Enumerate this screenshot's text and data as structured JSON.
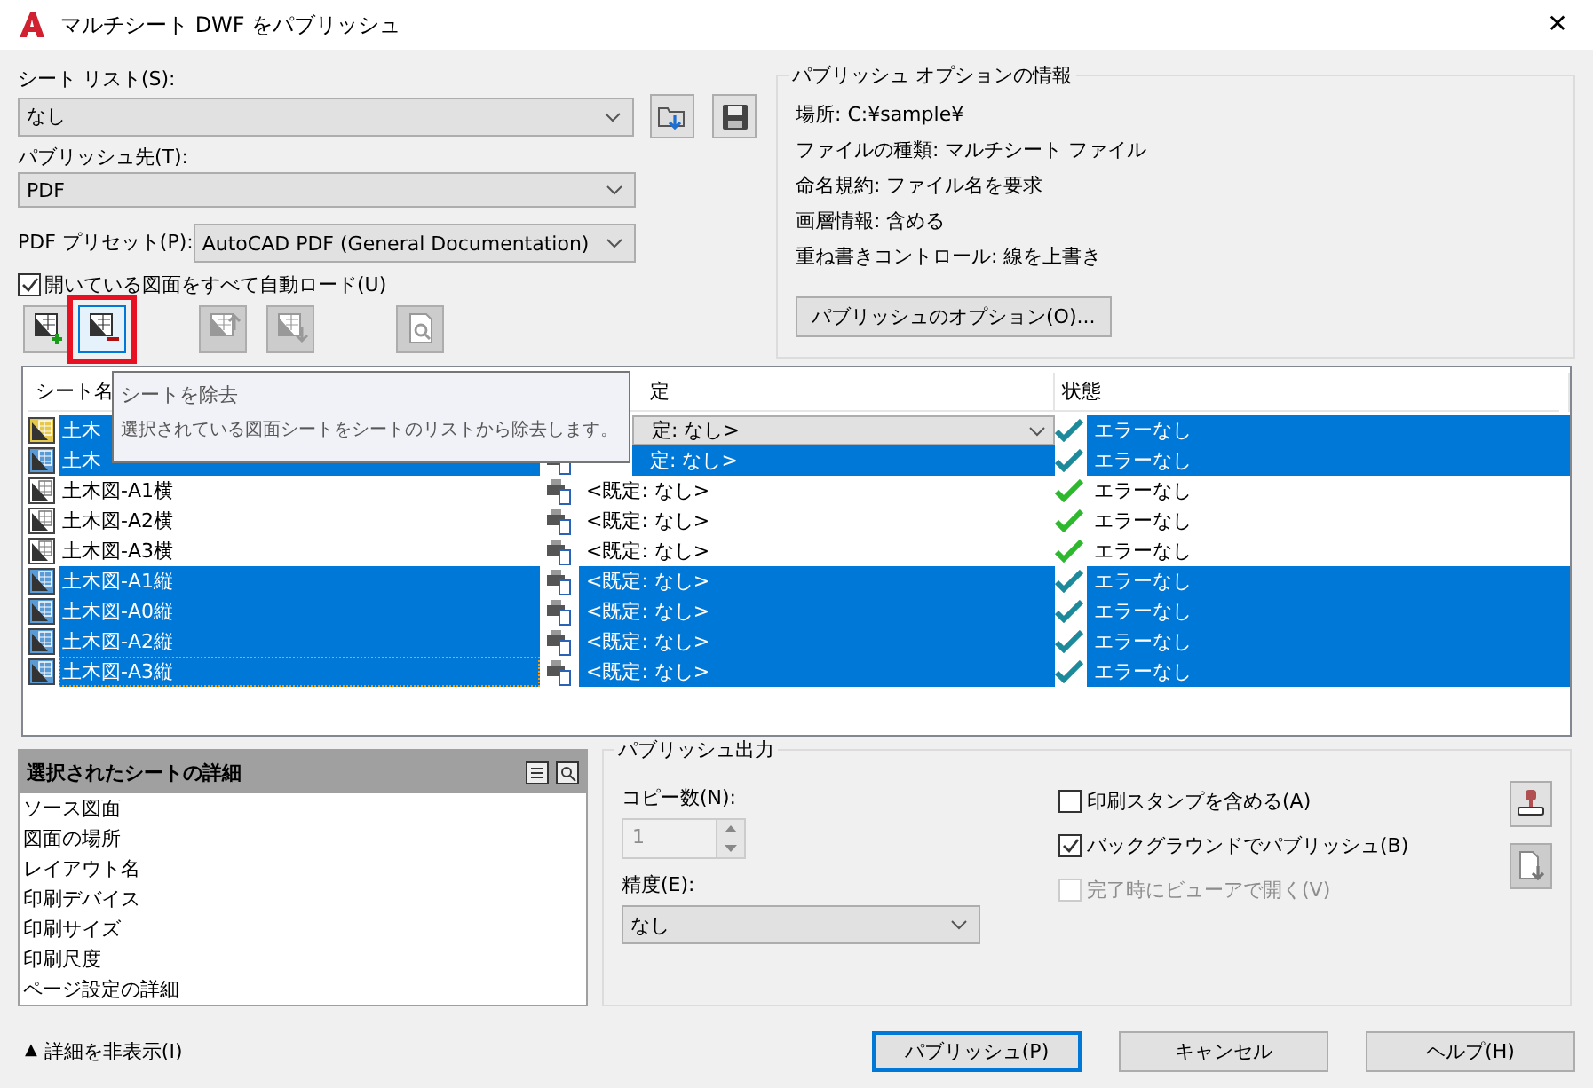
{
  "window": {
    "title": "マルチシート DWF をパブリッシュ",
    "close": "✕"
  },
  "sheet_list": {
    "label": "シート リスト(S):",
    "value": "なし"
  },
  "publish_to": {
    "label": "パブリッシュ先(T):",
    "value": "PDF"
  },
  "pdf_preset": {
    "label": "PDF プリセット(P):",
    "value": "AutoCAD PDF (General Documentation)"
  },
  "auto_load": {
    "label": "開いている図面をすべて自動ロード(U)",
    "checked": true
  },
  "toolbar": [
    {
      "kind": "add",
      "disabled": false,
      "highlighted": false
    },
    {
      "kind": "remove",
      "disabled": false,
      "highlighted": true
    },
    {
      "kind": "up",
      "disabled": true,
      "highlighted": false
    },
    {
      "kind": "down",
      "disabled": true,
      "highlighted": false
    },
    {
      "kind": "preview",
      "disabled": true,
      "highlighted": false
    }
  ],
  "options_info": {
    "title": "パブリッシュ オプションの情報",
    "lines": [
      "場所: C:¥sample¥",
      "ファイルの種類: マルチシート ファイル",
      "命名規約: ファイル名を要求",
      "画層情報: 含める",
      "重ね書きコントロール: 線を上書き"
    ],
    "button": "パブリッシュのオプション(O)..."
  },
  "tooltip": {
    "title": "シートを除去",
    "text": "選択されている図面シートをシートのリストから除去します。"
  },
  "table": {
    "columns": [
      {
        "label": "シート名",
        "clipped": false
      },
      {
        "label": "定",
        "clipped": true
      },
      {
        "label": "状態",
        "clipped": false
      }
    ],
    "rows": [
      {
        "name": "土木",
        "page_setup": "定: なし>",
        "setup_clipped": true,
        "status": "エラーなし",
        "selected": true,
        "current": true,
        "editing": true,
        "focused": false
      },
      {
        "name": "土木",
        "page_setup": "定: なし>",
        "setup_clipped": true,
        "status": "エラーなし",
        "selected": true,
        "current": false,
        "editing": false,
        "focused": false
      },
      {
        "name": "土木図-A1横",
        "page_setup": "<既定: なし>",
        "setup_clipped": false,
        "status": "エラーなし",
        "selected": false,
        "current": false,
        "editing": false,
        "focused": false
      },
      {
        "name": "土木図-A2横",
        "page_setup": "<既定: なし>",
        "setup_clipped": false,
        "status": "エラーなし",
        "selected": false,
        "current": false,
        "editing": false,
        "focused": false
      },
      {
        "name": "土木図-A3横",
        "page_setup": "<既定: なし>",
        "setup_clipped": false,
        "status": "エラーなし",
        "selected": false,
        "current": false,
        "editing": false,
        "focused": false
      },
      {
        "name": "土木図-A1縦",
        "page_setup": "<既定: なし>",
        "setup_clipped": false,
        "status": "エラーなし",
        "selected": true,
        "current": false,
        "editing": false,
        "focused": false
      },
      {
        "name": "土木図-A0縦",
        "page_setup": "<既定: なし>",
        "setup_clipped": false,
        "status": "エラーなし",
        "selected": true,
        "current": false,
        "editing": false,
        "focused": false
      },
      {
        "name": "土木図-A2縦",
        "page_setup": "<既定: なし>",
        "setup_clipped": false,
        "status": "エラーなし",
        "selected": true,
        "current": false,
        "editing": false,
        "focused": false
      },
      {
        "name": "土木図-A3縦",
        "page_setup": "<既定: なし>",
        "setup_clipped": false,
        "status": "エラーなし",
        "selected": true,
        "current": false,
        "editing": false,
        "focused": true
      }
    ]
  },
  "details": {
    "title": "選択されたシートの詳細",
    "items": [
      "ソース図面",
      "図面の場所",
      "レイアウト名",
      "印刷デバイス",
      "印刷サイズ",
      "印刷尺度",
      "ページ設定の詳細"
    ]
  },
  "publish_output": {
    "title": "パブリッシュ出力",
    "copies": {
      "label": "コピー数(N):",
      "value": "1",
      "disabled": true
    },
    "precision": {
      "label": "精度(E):",
      "value": "なし"
    },
    "checkboxes": [
      {
        "label": "印刷スタンプを含める(A)",
        "checked": false,
        "disabled": false
      },
      {
        "label": "バックグラウンドでパブリッシュ(B)",
        "checked": true,
        "disabled": false
      },
      {
        "label": "完了時にビューアで開く(V)",
        "checked": false,
        "disabled": true
      }
    ],
    "side_buttons": [
      {
        "kind": "stamp",
        "disabled": false
      },
      {
        "kind": "file",
        "disabled": true
      }
    ]
  },
  "toggle_details": {
    "icon": "▲",
    "label": "詳細を非表示(I)"
  },
  "buttons": [
    {
      "label": "パブリッシュ(P)",
      "default": true
    },
    {
      "label": "キャンセル",
      "default": false
    },
    {
      "label": "ヘルプ(H)",
      "default": false
    }
  ]
}
